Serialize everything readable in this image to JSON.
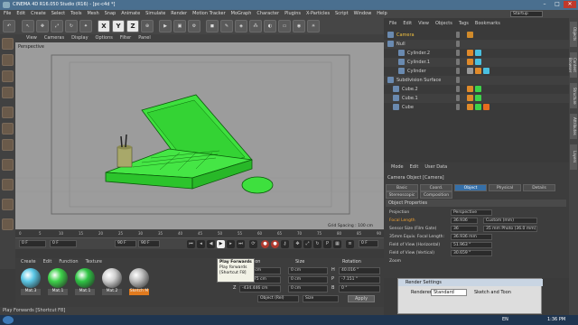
{
  "window": {
    "title": "CINEMA 4D R16.050 Studio (R16) - [pc-c4d *]",
    "layout": "Startup"
  },
  "menubar": [
    "File",
    "Edit",
    "Create",
    "Select",
    "Tools",
    "Mesh",
    "Snap",
    "Animate",
    "Simulate",
    "Render",
    "Motion Tracker",
    "MoGraph",
    "Character",
    "Plugins",
    "X-Particles",
    "Script",
    "Window",
    "Help"
  ],
  "toolbar": {
    "axes": [
      "X",
      "Y",
      "Z"
    ]
  },
  "viewport": {
    "menu": [
      "View",
      "Cameras",
      "Display",
      "Options",
      "Filter",
      "Panel"
    ],
    "label": "Perspective",
    "grid_spacing": "Grid Spacing : 100 cm"
  },
  "timeline": {
    "ticks": [
      "0",
      "5",
      "10",
      "15",
      "20",
      "25",
      "30",
      "35",
      "40",
      "45",
      "50",
      "55",
      "60",
      "65",
      "70",
      "75",
      "80",
      "85",
      "90"
    ],
    "current_frame": "0 F",
    "start_frame": "0 F",
    "end_frame": "90 F",
    "end_frame2": "90 F",
    "end_marker": "0 F"
  },
  "tooltip": {
    "title": "Play Forwards",
    "line1": "Play forwards",
    "line2": "[Shortcut F8]"
  },
  "material_manager": {
    "menu": [
      "Create",
      "Edit",
      "Function",
      "Texture"
    ],
    "materials": [
      {
        "label": "Mat.3",
        "color": "#5bc8e6"
      },
      {
        "label": "Mat.1",
        "color": "#3ed24a"
      },
      {
        "label": "Mat.1",
        "color": "#2fc444"
      },
      {
        "label": "Mat.2",
        "color": "#cfcfcf"
      },
      {
        "label": "Sketch M",
        "color": "#bdbdbd"
      }
    ]
  },
  "coordinates": {
    "headers": [
      "Position",
      "Size",
      "Rotation"
    ],
    "rows": [
      {
        "axis": "X",
        "pos": "423.3 cm",
        "size": "0 cm",
        "rot_axis": "H",
        "rot": "40.016 °"
      },
      {
        "axis": "Y",
        "pos": "140.475 cm",
        "size": "0 cm",
        "rot_axis": "P",
        "rot": "-7.151 °"
      },
      {
        "axis": "Z",
        "pos": "-434.446 cm",
        "size": "0 cm",
        "rot_axis": "B",
        "rot": "0 °"
      }
    ],
    "mode": "Object (Rel)",
    "size_mode": "Size",
    "apply": "Apply"
  },
  "object_manager": {
    "menu": [
      "File",
      "Edit",
      "View",
      "Objects",
      "Tags",
      "Bookmarks"
    ],
    "objects": [
      {
        "name": "Camera",
        "indent": 0
      },
      {
        "name": "Null",
        "indent": 0
      },
      {
        "name": "Cylinder.2",
        "indent": 2
      },
      {
        "name": "Cylinder.1",
        "indent": 2
      },
      {
        "name": "Cylinder",
        "indent": 2
      },
      {
        "name": "Subdivision Surface",
        "indent": 0
      },
      {
        "name": "Cube.2",
        "indent": 1
      },
      {
        "name": "Cube.1",
        "indent": 1
      },
      {
        "name": "Cube",
        "indent": 1
      }
    ]
  },
  "attribute_manager": {
    "menu": [
      "Mode",
      "Edit",
      "User Data"
    ],
    "title": "Camera Object [Camera]",
    "tabs": [
      "Basic",
      "Coord.",
      "Object",
      "Physical",
      "Details"
    ],
    "tabs2": [
      "Stereoscopic",
      "Composition"
    ],
    "section": "Object Properties",
    "properties": [
      {
        "label": "Projection",
        "value": "Perspective"
      },
      {
        "label": "Focal Length",
        "value": "36.936",
        "extra": "Custom (mm)"
      },
      {
        "label": "Sensor Size (Film Gate)",
        "value": "36",
        "extra": "35 mm Photo (36.0 mm)"
      },
      {
        "label": "35mm Equiv. Focal Length:",
        "value": "36.936 mm"
      },
      {
        "label": "Field of View (Horizontal)",
        "value": "51.963 °"
      },
      {
        "label": "Field of View (Vertical)",
        "value": "30.659 °"
      },
      {
        "label": "Zoom",
        "value": ""
      }
    ]
  },
  "render_settings": {
    "title": "Render Settings",
    "renderer_label": "Renderer",
    "renderer": "Standard",
    "item": "Sketch and Toon"
  },
  "status": "Play Forwards [Shortcut F8]",
  "right_tabs": [
    "Objects",
    "Content Browser",
    "Structure",
    "Attributes",
    "Layers"
  ],
  "taskbar": {
    "lang": "EN",
    "time": "1:36 PM"
  }
}
